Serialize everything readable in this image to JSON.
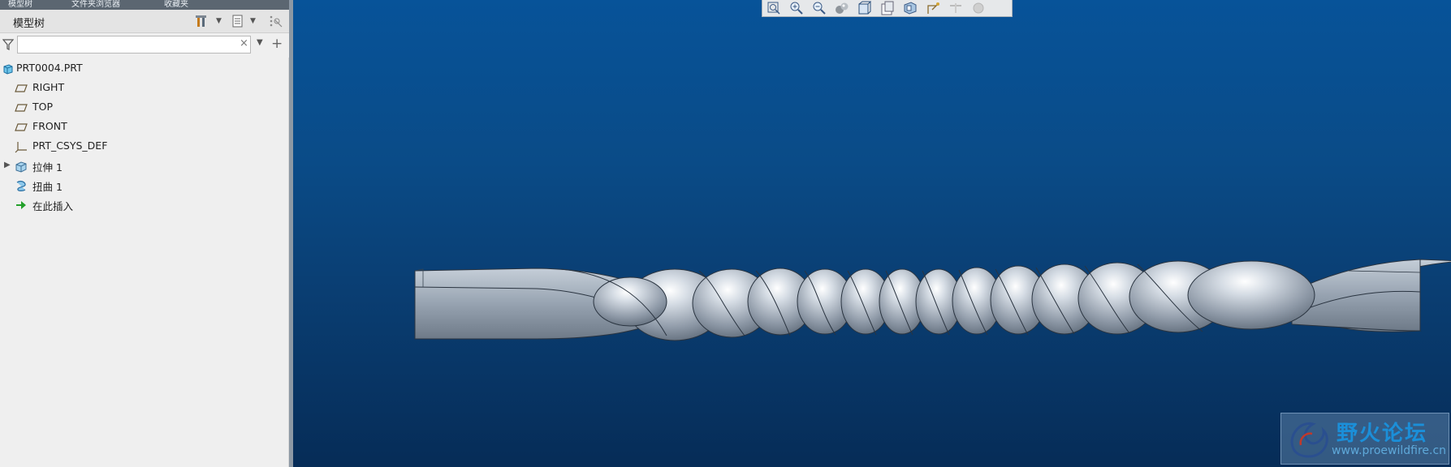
{
  "panel": {
    "tabs": [
      "模型树",
      "文件夹浏览器",
      "收藏夹"
    ],
    "title": "模型树",
    "icons": [
      "show-tools-icon",
      "settings-icon",
      "more-icon"
    ]
  },
  "filter": {
    "value": "",
    "placeholder": "",
    "clear": "×"
  },
  "tree": {
    "items": [
      {
        "label": "PRT0004.PRT",
        "icon": "part-icon"
      },
      {
        "label": "RIGHT",
        "icon": "datum-plane-icon"
      },
      {
        "label": "TOP",
        "icon": "datum-plane-icon"
      },
      {
        "label": "FRONT",
        "icon": "datum-plane-icon"
      },
      {
        "label": "PRT_CSYS_DEF",
        "icon": "coordinate-system-icon"
      },
      {
        "label": "拉伸 1",
        "icon": "extrude-icon"
      },
      {
        "label": "扭曲 1",
        "icon": "twist-icon"
      },
      {
        "label": "在此插入",
        "icon": "insert-here-icon"
      }
    ]
  },
  "view_toolbar": {
    "buttons": [
      "refit-icon",
      "zoom-in-icon",
      "zoom-out-icon",
      "repaint-icon",
      "display-style-icon",
      "saved-orientations-icon",
      "view-manager-icon",
      "datum-display-icon",
      "annotation-icon",
      "spin-center-icon"
    ]
  },
  "watermark": {
    "title": "野火论坛",
    "url": "www.proewildfire.cn"
  },
  "colors": {
    "viewport_top": "#075399",
    "viewport_bottom": "#062c57",
    "model": "#9aa6b4"
  }
}
